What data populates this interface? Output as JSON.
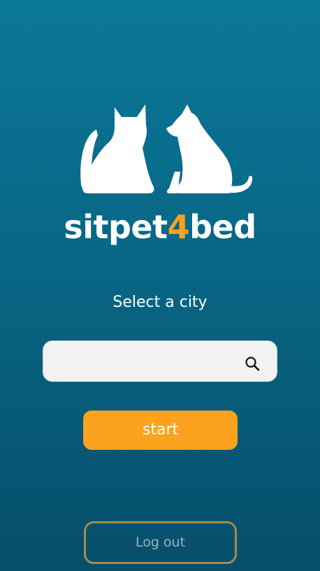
{
  "brand": {
    "name_part1": "sitpet",
    "name_accent": "4",
    "name_part2": "bed",
    "logo_icon": "cat-and-dog-silhouette-icon"
  },
  "city_select": {
    "label": "Select a city",
    "search_value": "",
    "search_placeholder": "",
    "search_icon": "search-icon"
  },
  "actions": {
    "start_label": "start",
    "logout_label": "Log out"
  },
  "colors": {
    "background_top": "#0b7799",
    "background_bottom": "#064e6a",
    "accent_orange": "#fba31f",
    "logout_border": "#a58a4c"
  }
}
